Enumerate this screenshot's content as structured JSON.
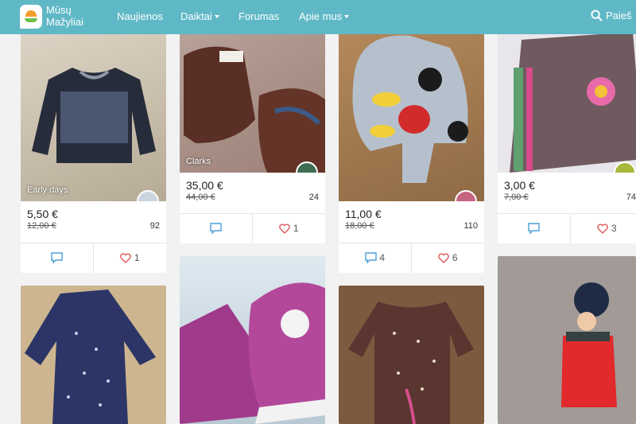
{
  "header": {
    "brand_line1": "Mūsų",
    "brand_line2": "Mažyliai",
    "nav": [
      "Naujienos",
      "Daiktai",
      "Forumas",
      "Apie mus"
    ],
    "search_label": "Paieš"
  },
  "cards": [
    {
      "caption": "Early days",
      "price": "5,50 €",
      "old_price": "12,00 €",
      "views": "92",
      "comments": "",
      "likes": "1"
    },
    {
      "caption": "Clarks",
      "price": "35,00 €",
      "old_price": "44,00 €",
      "views": "24",
      "comments": "",
      "likes": "1"
    },
    {
      "caption": "",
      "price": "11,00 €",
      "old_price": "18,00 €",
      "views": "110",
      "comments": "4",
      "likes": "6"
    },
    {
      "caption": "",
      "price": "3,00 €",
      "old_price": "7,00 €",
      "views": "74",
      "comments": "",
      "likes": "3"
    }
  ],
  "colors": {
    "header": "#5fb8c6",
    "accent": "#4a9fd8",
    "heart": "#e05a5a"
  }
}
